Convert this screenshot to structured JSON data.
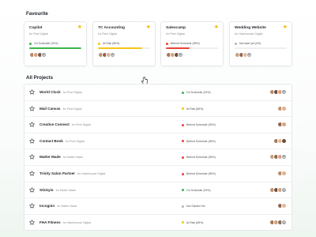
{
  "favourite": {
    "title": "Favourite",
    "cards": [
      {
        "name": "Copilot",
        "client": "for Pixel Digital",
        "status": "On Schedule (25%)",
        "status_color": "#3bb54a",
        "progress": 1.0,
        "avatars": [
          "#b88a6a",
          "#d9a07e",
          "#7a5a48"
        ],
        "more": "+3"
      },
      {
        "name": "TC Accounting",
        "client": "for Pixel Digital",
        "status": "At Risk (85%)",
        "status_color": "#f5c518",
        "progress": 0.85,
        "avatars": [
          "#c49070",
          "#8c6550",
          "#e0b08e"
        ],
        "more": "+3"
      },
      {
        "name": "Salescamp",
        "client": "for Pixel Digital",
        "status": "Behind Schedule (95%)",
        "status_color": "#ea4335",
        "progress": 0.45,
        "avatars": [
          "#a77658",
          "#d4a382",
          "#6e4d3c"
        ],
        "more": "+3"
      },
      {
        "name": "Wedding Website",
        "client": "for Hatchhouse Digital",
        "status": "Not start yet (0%)",
        "status_color": "#b0b5bb",
        "progress": 0,
        "avatars": [
          "#caa07f",
          "#8d6a55",
          "#e2b896"
        ],
        "more": "+3"
      }
    ]
  },
  "projects": {
    "title": "All Projects",
    "rows": [
      {
        "name": "World Clock",
        "client": "for Pixel Digital",
        "status": "On Schedule (25%)",
        "status_color": "#3bb54a",
        "avatars": [
          "#b88a6a",
          "#6e4d3c",
          "#d9a07e"
        ],
        "more": "+3"
      },
      {
        "name": "Mail Canvas",
        "client": "for Pixel Digital",
        "status": "At Risk (85%)",
        "status_color": "#f5c518",
        "avatars": [
          "#c49070",
          "#e0b08e"
        ],
        "more": ""
      },
      {
        "name": "Creative Connect",
        "client": "for Pixel Digital",
        "status": "Behind Schedule (90%)",
        "status_color": "#ea4335",
        "avatars": [
          "#8c6550",
          "#d4a382"
        ],
        "more": ""
      },
      {
        "name": "Contact Book",
        "client": "for Pixel Digital",
        "status": "Behind Schedule (95%)",
        "status_color": "#ea4335",
        "avatars": [
          "#a77658",
          "#e2b896",
          "#6e4d3c"
        ],
        "more": ""
      },
      {
        "name": "Matter Made",
        "client": "for Matter Made",
        "status": "Behind Schedule (95%)",
        "status_color": "#ea4335",
        "avatars": [
          "#caa07f",
          "#8d6a55",
          "#d9a07e"
        ],
        "more": "+3"
      },
      {
        "name": "Trinity Salon Partner",
        "client": "for Hatchhouse Digital",
        "status": "Behind Schedule (95%)",
        "status_color": "#ea4335",
        "avatars": [
          "#b88a6a",
          "#e0b08e"
        ],
        "more": ""
      },
      {
        "name": "Stickyio",
        "client": "for Matter Made",
        "status": "On Schedule (25%)",
        "status_color": "#3bb54a",
        "avatars": [
          "#c49070",
          "#6e4d3c",
          "#d4a382"
        ],
        "more": "+3"
      },
      {
        "name": "Incognin",
        "client": "for Matter Made",
        "status": "Not Started Yet",
        "status_color": "#b0b5bb",
        "avatars": [
          "#8c6550",
          "#e2b896"
        ],
        "more": ""
      },
      {
        "name": "FHA Fitness",
        "client": "for Hatchhouse Digital",
        "status": "At Risk (65%)",
        "status_color": "#f5c518",
        "avatars": [
          "#a77658",
          "#caa07f",
          "#8d6a55"
        ],
        "more": "+3"
      }
    ]
  }
}
